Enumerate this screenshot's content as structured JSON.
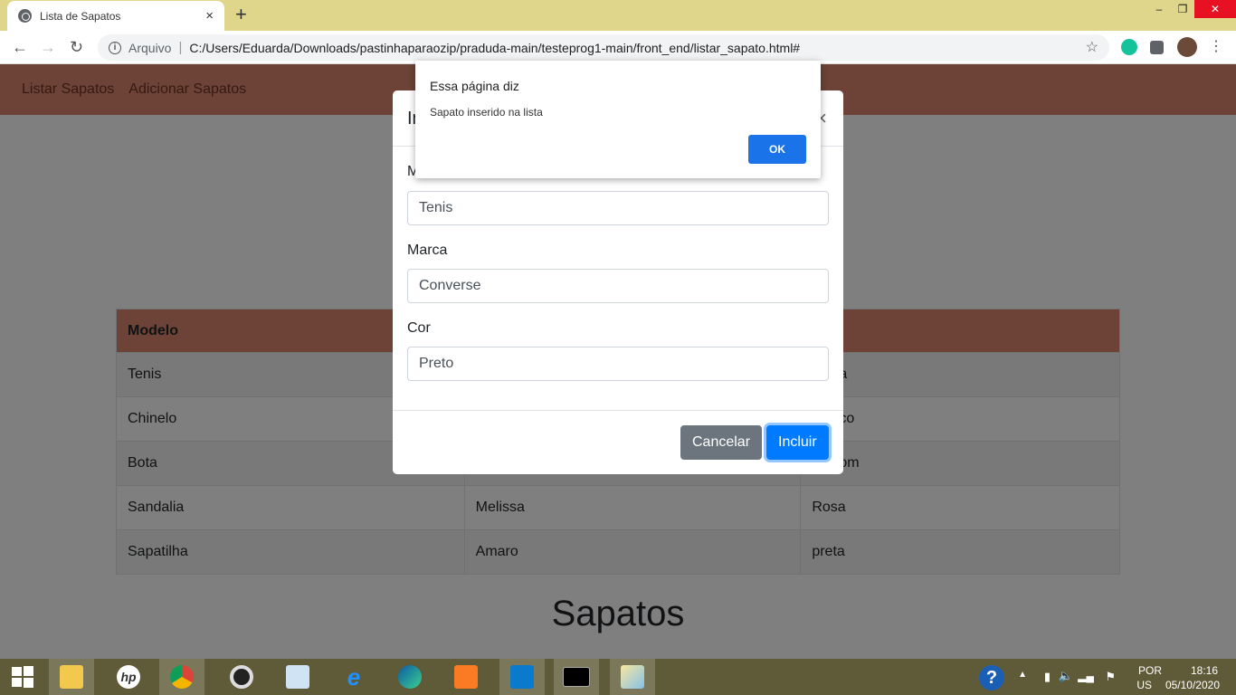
{
  "browser": {
    "tab_title": "Lista de Sapatos",
    "tab_close": "×",
    "new_tab": "+",
    "protocol_label": "Arquivo",
    "separator": "|",
    "url": "C:/Users/Eduarda/Downloads/pastinhaparaozip/praduda-main/testeprog1-main/front_end/listar_sapato.html#"
  },
  "navbar": {
    "items": [
      "Listar Sapatos",
      "Adicionar Sapatos"
    ]
  },
  "table": {
    "headers": [
      "Modelo",
      "",
      ""
    ],
    "rows": [
      [
        "Tenis",
        "",
        "a"
      ],
      [
        "Chinelo",
        "",
        "co"
      ],
      [
        "Bota",
        "",
        "om"
      ],
      [
        "Sandalia",
        "Melissa",
        "Rosa"
      ],
      [
        "Sapatilha",
        "Amaro",
        "preta"
      ]
    ]
  },
  "page_heading": "Sapatos",
  "modal": {
    "title": "In",
    "close": "×",
    "fields": [
      {
        "label": "M",
        "value": "Tenis"
      },
      {
        "label": "Marca",
        "value": "Converse"
      },
      {
        "label": "Cor",
        "value": "Preto"
      }
    ],
    "cancel_label": "Cancelar",
    "submit_label": "Incluir"
  },
  "alert": {
    "title": "Essa página diz",
    "message": "Sapato inserido na lista",
    "ok_label": "OK"
  },
  "taskbar": {
    "language": "POR",
    "layout": "US",
    "time": "18:16",
    "date": "05/10/2020"
  },
  "colors": {
    "navbar": "#d9876c",
    "primary": "#007bff",
    "secondary": "#6c757d",
    "tabstrip": "#dfd68b",
    "taskbar": "#5f5a37"
  }
}
